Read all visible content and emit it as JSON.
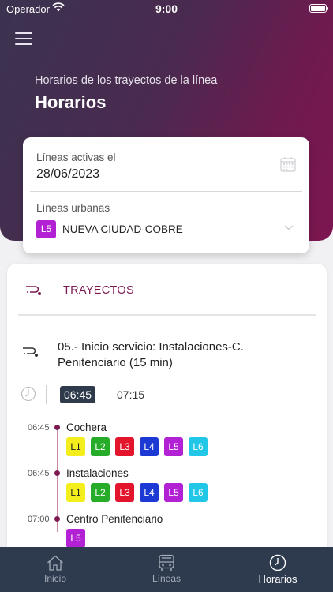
{
  "status": {
    "carrier": "Operador",
    "time": "9:00"
  },
  "header": {
    "subtitle": "Horarios de los trayectos de la línea",
    "title": "Horarios"
  },
  "filter": {
    "active_label": "Líneas activas el",
    "date": "28/06/2023",
    "urban_label": "Líneas urbanas",
    "selected_line": {
      "code": "L5",
      "name": "NUEVA CIUDAD-COBRE"
    }
  },
  "section": {
    "title": "TRAYECTOS"
  },
  "route": {
    "title": "05.- Inicio servicio: Instalaciones-C. Penitenciario (15 min)",
    "times": [
      "06:45",
      "07:15"
    ]
  },
  "stops": [
    {
      "time": "06:45",
      "name": "Cochera",
      "lines": [
        "L1",
        "L2",
        "L3",
        "L4",
        "L5",
        "L6"
      ]
    },
    {
      "time": "06:45",
      "name": "Instalaciones",
      "lines": [
        "L1",
        "L2",
        "L3",
        "L4",
        "L5",
        "L6"
      ]
    },
    {
      "time": "07:00",
      "name": "Centro Penitenciario",
      "lines": [
        "L5"
      ]
    }
  ],
  "line_colors": {
    "L1": {
      "bg": "#f4ee1c",
      "fg": "#222222"
    },
    "L2": {
      "bg": "#27ac2a",
      "fg": "#ffffff"
    },
    "L3": {
      "bg": "#e2152c",
      "fg": "#ffffff"
    },
    "L4": {
      "bg": "#1d39d3",
      "fg": "#ffffff"
    },
    "L5": {
      "bg": "#b321d4",
      "fg": "#ffffff"
    },
    "L6": {
      "bg": "#22c6e6",
      "fg": "#ffffff"
    }
  },
  "tabs": [
    {
      "label": "Inicio",
      "icon": "home-icon"
    },
    {
      "label": "Líneas",
      "icon": "bus-icon"
    },
    {
      "label": "Horarios",
      "icon": "clock-icon",
      "active": true
    }
  ],
  "colors": {
    "accent": "#7d1a52",
    "tabbar": "#2e3a4d"
  }
}
